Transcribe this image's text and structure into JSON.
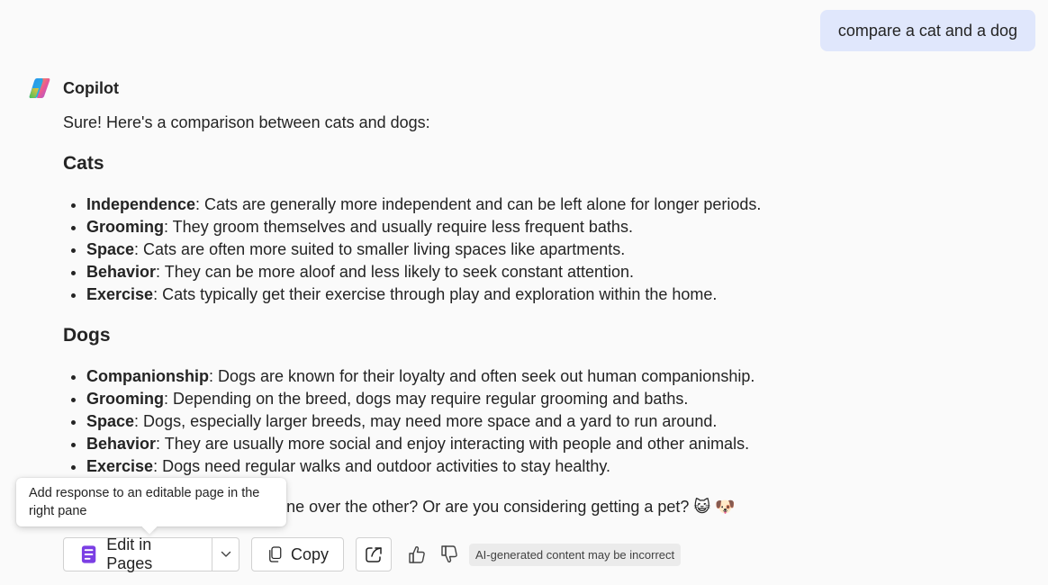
{
  "user_message": "compare a cat and a dog",
  "assistant": {
    "name": "Copilot",
    "intro": "Sure! Here's a comparison between cats and dogs:",
    "sections": [
      {
        "heading": "Cats",
        "items": [
          {
            "term": "Independence",
            "text": ": Cats are generally more independent and can be left alone for longer periods."
          },
          {
            "term": "Grooming",
            "text": ": They groom themselves and usually require less frequent baths."
          },
          {
            "term": "Space",
            "text": ": Cats are often more suited to smaller living spaces like apartments."
          },
          {
            "term": "Behavior",
            "text": ": They can be more aloof and less likely to seek constant attention."
          },
          {
            "term": "Exercise",
            "text": ": Cats typically get their exercise through play and exploration within the home."
          }
        ]
      },
      {
        "heading": "Dogs",
        "items": [
          {
            "term": "Companionship",
            "text": ": Dogs are known for their loyalty and often seek out human companionship."
          },
          {
            "term": "Grooming",
            "text": ": Depending on the breed, dogs may require regular grooming and baths."
          },
          {
            "term": "Space",
            "text": ": Dogs, especially larger breeds, may need more space and a yard to run around."
          },
          {
            "term": "Behavior",
            "text": ": They are usually more social and enjoy interacting with people and other animals."
          },
          {
            "term": "Exercise",
            "text": ": Dogs need regular walks and outdoor activities to stay healthy."
          }
        ]
      }
    ],
    "closing": "Do you have a preference for one over the other? Or are you considering getting a pet? 😺 🐶"
  },
  "tooltip": "Add response to an editable page in the right pane",
  "toolbar": {
    "edit_label": "Edit in Pages",
    "copy_label": "Copy",
    "disclaimer": "AI-generated content may be incorrect"
  },
  "icons": {
    "logo": "copilot-logo-icon",
    "pages": "pages-icon",
    "chevron": "chevron-down-icon",
    "copy": "copy-icon",
    "share": "share-icon",
    "thumbs_up": "thumbs-up-icon",
    "thumbs_down": "thumbs-down-icon"
  },
  "colors": {
    "user_bubble": "#e0e7fc",
    "background": "#fafafa",
    "pages_icon": "#7b3fe4"
  }
}
